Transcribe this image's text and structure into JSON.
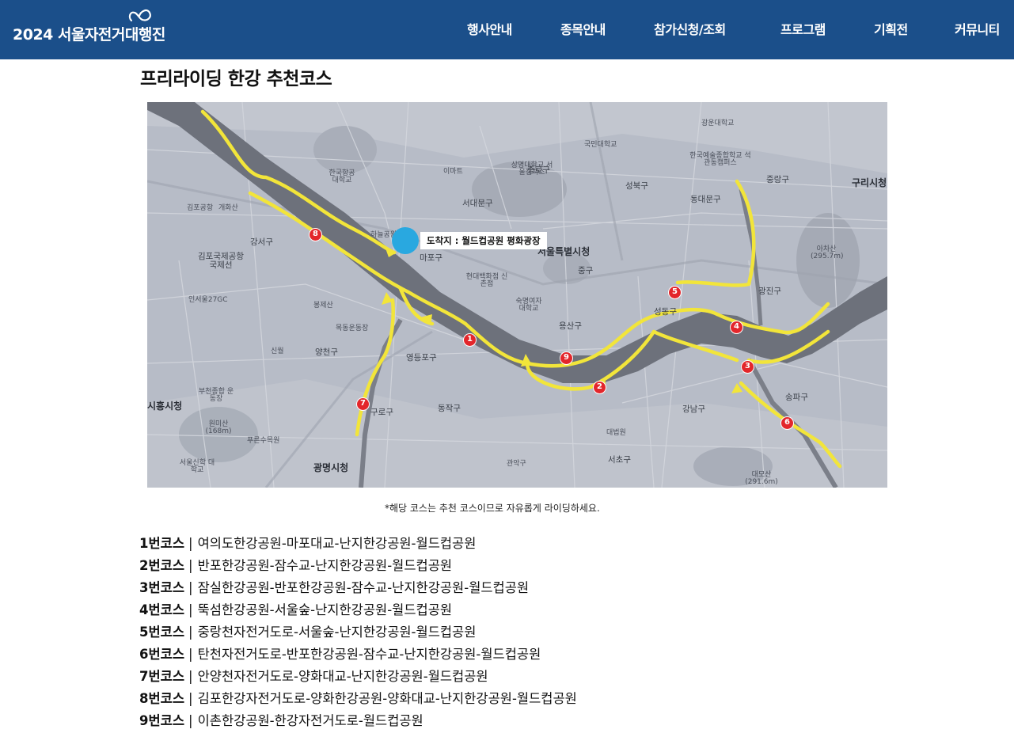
{
  "header": {
    "logo_text": "2024 서울자전거대행진",
    "nav": [
      "행사안내",
      "종목안내",
      "참가신청/조회",
      "프로그램",
      "기획전",
      "커뮤니티"
    ],
    "brand_color": "#1b4f8a"
  },
  "page_title": "프리라이딩 한강 추천코스",
  "map": {
    "destination_label": "도착지 : 월드컵공원 평화광장",
    "markers": [
      "1",
      "2",
      "3",
      "4",
      "5",
      "6",
      "7",
      "8",
      "9"
    ],
    "labels": {
      "seoul_city_hall": "서울특별시청",
      "gwangmyeong": "광명시청",
      "guri": "구리시청",
      "siheung": "시흥시청",
      "gangseo": "강서구",
      "gimpo_airport": "김포국제공항 국제선",
      "incheon": "인서울27GC",
      "yangcheon": "양천구",
      "yeongdeungpo": "영등포구",
      "mapo": "마포구",
      "jung": "중구",
      "yongsan": "용산구",
      "seongdong": "성동구",
      "gwangjin": "광진구",
      "gangnam": "강남구",
      "seocho": "서초구",
      "songpa": "송파구",
      "dongjak": "동작구",
      "guro": "구로구",
      "dongdaemun": "동대문구",
      "jongno": "종로구",
      "seodaemun": "서대문구",
      "seongbuk": "성북구",
      "jungnang": "중랑구",
      "achasan": "아차산 (295.7m)",
      "daemosan": "대모산 (291.6m)",
      "wonmisan": "원미산 (168m)",
      "bucheon_sports": "부천종합 운동장",
      "hyundai": "현대백화점 신촌점",
      "emart": "이마트",
      "hanyang": "한국항공 대학교",
      "sangmyung": "상명대학교 서울캠퍼스",
      "kookmin": "국민대학교",
      "kaywon": "한국예술종합학교 석관동캠퍼스",
      "daebub": "대법원",
      "sookmyung": "숙명여자 대학교",
      "seoul_sinhak": "서울신학 대학교",
      "gimpo_airport_short": "김포공항",
      "gaehwa": "개화산",
      "bongjesan": "봉제산",
      "sinwol": "신월",
      "mokdong": "목동운동장",
      "haneul": "하늘공원",
      "puru": "푸른수목원",
      "gwanak": "관악구",
      "gwangwoon": "광운대학교"
    }
  },
  "note": "*해당 코스는 추천 코스이므로 자유롭게 라이딩하세요.",
  "courses": [
    {
      "num": "1번코스",
      "route": "여의도한강공원-마포대교-난지한강공원-월드컵공원"
    },
    {
      "num": "2번코스",
      "route": "반포한강공원-잠수교-난지한강공원-월드컵공원"
    },
    {
      "num": "3번코스",
      "route": "잠실한강공원-반포한강공원-잠수교-난지한강공원-월드컵공원"
    },
    {
      "num": "4번코스",
      "route": "뚝섬한강공원-서울숲-난지한강공원-월드컵공원"
    },
    {
      "num": "5번코스",
      "route": "중랑천자전거도로-서울숲-난지한강공원-월드컵공원"
    },
    {
      "num": "6번코스",
      "route": "탄천자전거도로-반포한강공원-잠수교-난지한강공원-월드컵공원"
    },
    {
      "num": "7번코스",
      "route": "안양천자전거도로-양화대교-난지한강공원-월드컵공원"
    },
    {
      "num": "8번코스",
      "route": "김포한강자전거도로-양화한강공원-양화대교-난지한강공원-월드컵공원"
    },
    {
      "num": "9번코스",
      "route": "이촌한강공원-한강자전거도로-월드컵공원"
    }
  ],
  "colors": {
    "route": "#f2e53a",
    "marker": "#e3262b",
    "destination": "#29a8e0",
    "river": "#6d717b"
  }
}
